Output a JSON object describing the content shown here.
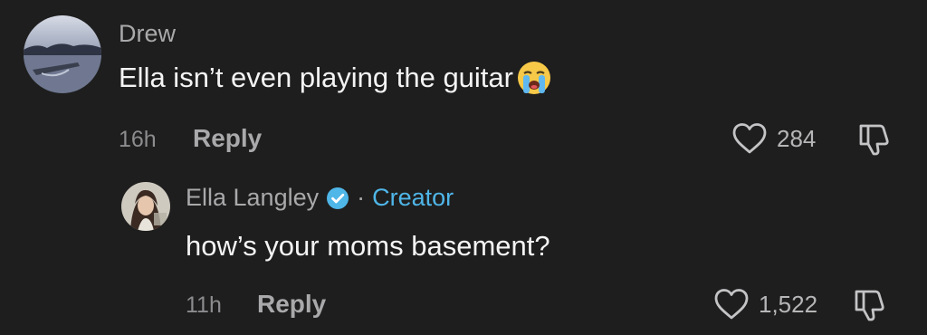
{
  "comments": [
    {
      "username": "Drew",
      "text": "Ella isn’t even playing the guitar",
      "emoji": "loudly-crying-face-icon",
      "time": "16h",
      "reply_label": "Reply",
      "likes": "284",
      "replies": [
        {
          "username": "Ella Langley",
          "verified": true,
          "separator": "·",
          "badge": "Creator",
          "text": "how’s your moms basement?",
          "time": "11h",
          "reply_label": "Reply",
          "likes": "1,522"
        }
      ]
    }
  ],
  "colors": {
    "background": "#1e1e1e",
    "creator_accent": "#4fb6e8",
    "verified_badge": "#4fb6e8"
  }
}
